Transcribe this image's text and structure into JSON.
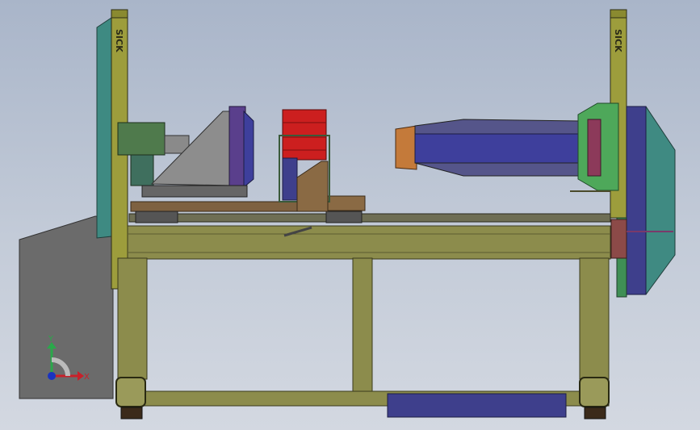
{
  "scene": {
    "sensor_brand_left": "SICK",
    "sensor_brand_right": "SICK",
    "triad": {
      "x_label": "X",
      "y_label": "Y"
    }
  },
  "colors": {
    "background_top": "#a9b5c9",
    "background_bottom": "#d3d8e1",
    "frame": "#8c8c4c",
    "frame_dark": "#5d5d2f",
    "light_curtain": "#9c9c3c",
    "teal_panel": "#3f8a82",
    "gray_panel": "#6a6a6a",
    "purple_unit": "#3e3f8c",
    "red_stack": "#cc1f1f",
    "green_ring": "#4ea85a",
    "brown_rail": "#7e6140",
    "axis_x": "#c8202a",
    "axis_y": "#2aa84a",
    "axis_z": "#1a33c0"
  }
}
